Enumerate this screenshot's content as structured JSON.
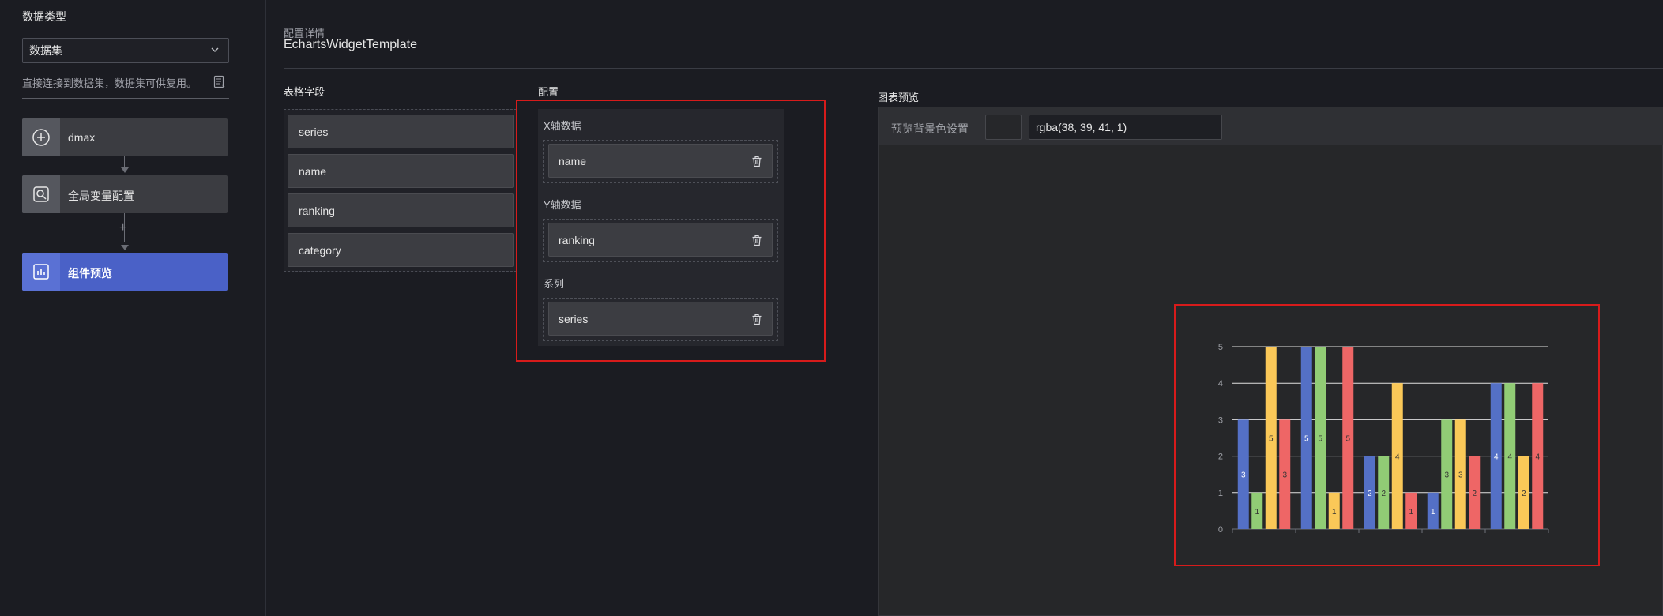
{
  "sidebar": {
    "title": "数据类型",
    "select_value": "数据集",
    "description": "直接连接到数据集，数据集可供复用。",
    "nodes": [
      {
        "label": "dmax",
        "icon": "plus-circle-icon"
      },
      {
        "label": "全局变量配置",
        "icon": "variable-search-icon"
      },
      {
        "label": "组件预览",
        "icon": "chart-preview-icon"
      }
    ],
    "add_symbol": "+"
  },
  "header": {
    "caption": "配置详情",
    "title": "EchartsWidgetTemplate"
  },
  "fields": {
    "label": "表格字段",
    "items": [
      "series",
      "name",
      "ranking",
      "category"
    ]
  },
  "config": {
    "label": "配置",
    "x_label": "X轴数据",
    "x_value": "name",
    "y_label": "Y轴数据",
    "y_value": "ranking",
    "series_label": "系列",
    "series_value": "series"
  },
  "preview": {
    "label": "图表预览",
    "bg_label": "预览背景色设置",
    "bg_value": "rgba(38, 39, 41, 1)"
  },
  "colors": {
    "accent": "#4a61c7",
    "highlight_border": "#d71b1b",
    "series": [
      "#5470c6",
      "#91cc75",
      "#fac858",
      "#ee6666"
    ]
  },
  "chart_data": {
    "type": "bar",
    "categories": [
      "",
      "",
      "",
      "",
      ""
    ],
    "series": [
      {
        "values": [
          3,
          5,
          2,
          1,
          4
        ]
      },
      {
        "values": [
          1,
          5,
          2,
          3,
          4
        ]
      },
      {
        "values": [
          5,
          1,
          4,
          3,
          2
        ]
      },
      {
        "values": [
          3,
          5,
          1,
          2,
          4
        ]
      }
    ],
    "ylim": [
      0,
      5
    ],
    "yticks": [
      "0",
      "1",
      "2",
      "3",
      "4",
      "5"
    ],
    "grid": true,
    "data_labels": true
  }
}
